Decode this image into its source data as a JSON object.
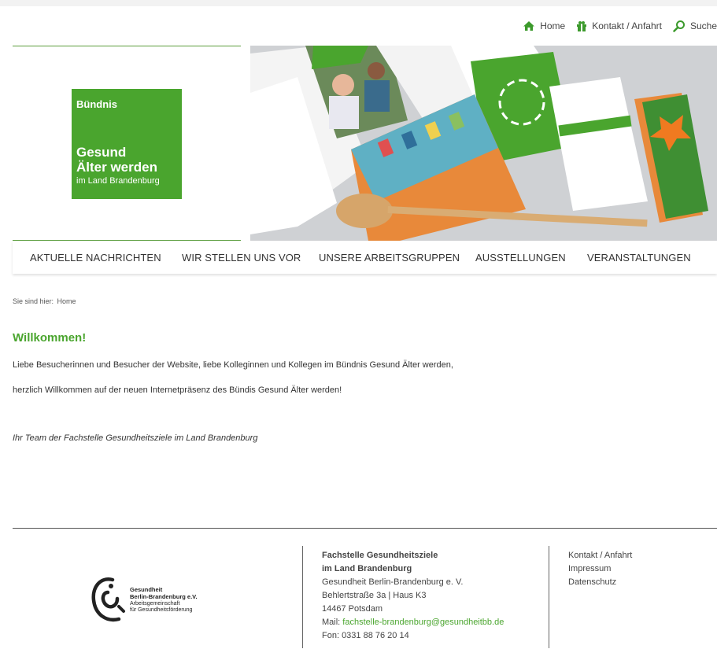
{
  "topbar": {
    "home": "Home",
    "contact": "Kontakt / Anfahrt",
    "search": "Suche"
  },
  "logo": {
    "line1": "Bündnis",
    "line2": "Gesund",
    "line3": "Älter werden",
    "line4": "im Land Brandenburg"
  },
  "nav": {
    "items": [
      "AKTUELLE NACHRICHTEN",
      "WIR STELLEN UNS VOR",
      "UNSERE ARBEITSGRUPPEN",
      "AUSSTELLUNGEN",
      "VERANSTALTUNGEN"
    ]
  },
  "breadcrumb": {
    "prefix": "Sie sind hier:",
    "current": "Home"
  },
  "main": {
    "title": "Willkommen!",
    "p1": "Liebe Besucherinnen und Besucher der Website, liebe Kolleginnen und Kollegen im Bündnis Gesund Älter werden,",
    "p2": "herzlich Willkommen auf der neuen Internetpräsenz des Bündis Gesund Älter werden!",
    "signature": "Ihr Team der Fachstelle Gesundheitsziele im Land Brandenburg"
  },
  "footer": {
    "org_logo": {
      "name1": "Gesundheit",
      "name2": "Berlin-Brandenburg e.V.",
      "sub1": "Arbeitsgemeinschaft",
      "sub2": "für Gesundheitsförderung"
    },
    "address": {
      "title1": "Fachstelle Gesundheitsziele",
      "title2": "im Land Brandenburg",
      "org": "Gesundheit Berlin-Brandenburg e. V.",
      "street": "Behlertstraße 3a | Haus K3",
      "city": "14467 Potsdam",
      "mail_label": "Mail:",
      "mail": "fachstelle-brandenburg@gesundheitbb.de",
      "phone": "Fon: 0331 88 76 20 14"
    },
    "links": [
      "Kontakt / Anfahrt",
      "Impressum",
      "Datenschutz"
    ]
  },
  "colors": {
    "accent": "#4aa52e",
    "icon": "#3c9a2c"
  }
}
